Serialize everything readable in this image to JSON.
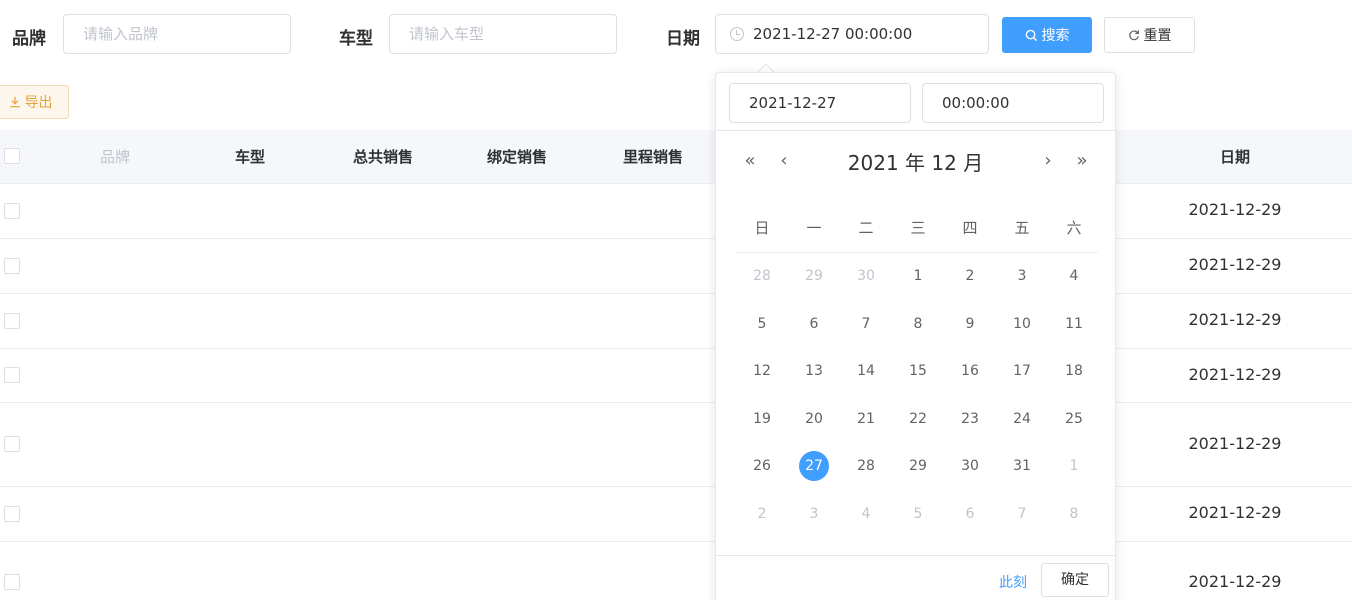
{
  "search_form": {
    "brand_label": "品牌",
    "brand_placeholder": "请输入品牌",
    "model_label": "车型",
    "model_placeholder": "请输入车型",
    "date_label": "日期",
    "date_value": "2021-12-27 00:00:00",
    "search_button": "搜索",
    "reset_button": "重置"
  },
  "toolbar": {
    "export_button": "导出"
  },
  "table": {
    "columns": [
      "品牌",
      "车型",
      "总共销售",
      "绑定销售",
      "里程销售",
      "日期"
    ],
    "rows": [
      {
        "date": "2021-12-29"
      },
      {
        "date": "2021-12-29"
      },
      {
        "date": "2021-12-29"
      },
      {
        "date": "2021-12-29"
      },
      {
        "date": "2021-12-29"
      },
      {
        "date": "2021-12-29"
      },
      {
        "date": "2021-12-29"
      }
    ]
  },
  "date_picker": {
    "date_input": "2021-12-27",
    "time_input": "00:00:00",
    "header_title": "2021 年  12 月",
    "weekdays": [
      "日",
      "一",
      "二",
      "三",
      "四",
      "五",
      "六"
    ],
    "weeks": [
      [
        "28",
        "29",
        "30",
        "1",
        "2",
        "3",
        "4"
      ],
      [
        "5",
        "6",
        "7",
        "8",
        "9",
        "10",
        "11"
      ],
      [
        "12",
        "13",
        "14",
        "15",
        "16",
        "17",
        "18"
      ],
      [
        "19",
        "20",
        "21",
        "22",
        "23",
        "24",
        "25"
      ],
      [
        "26",
        "27",
        "28",
        "29",
        "30",
        "31",
        "1"
      ],
      [
        "2",
        "3",
        "4",
        "5",
        "6",
        "7",
        "8"
      ]
    ],
    "selected_day": "27",
    "now_link": "此刻",
    "confirm_button": "确定"
  }
}
